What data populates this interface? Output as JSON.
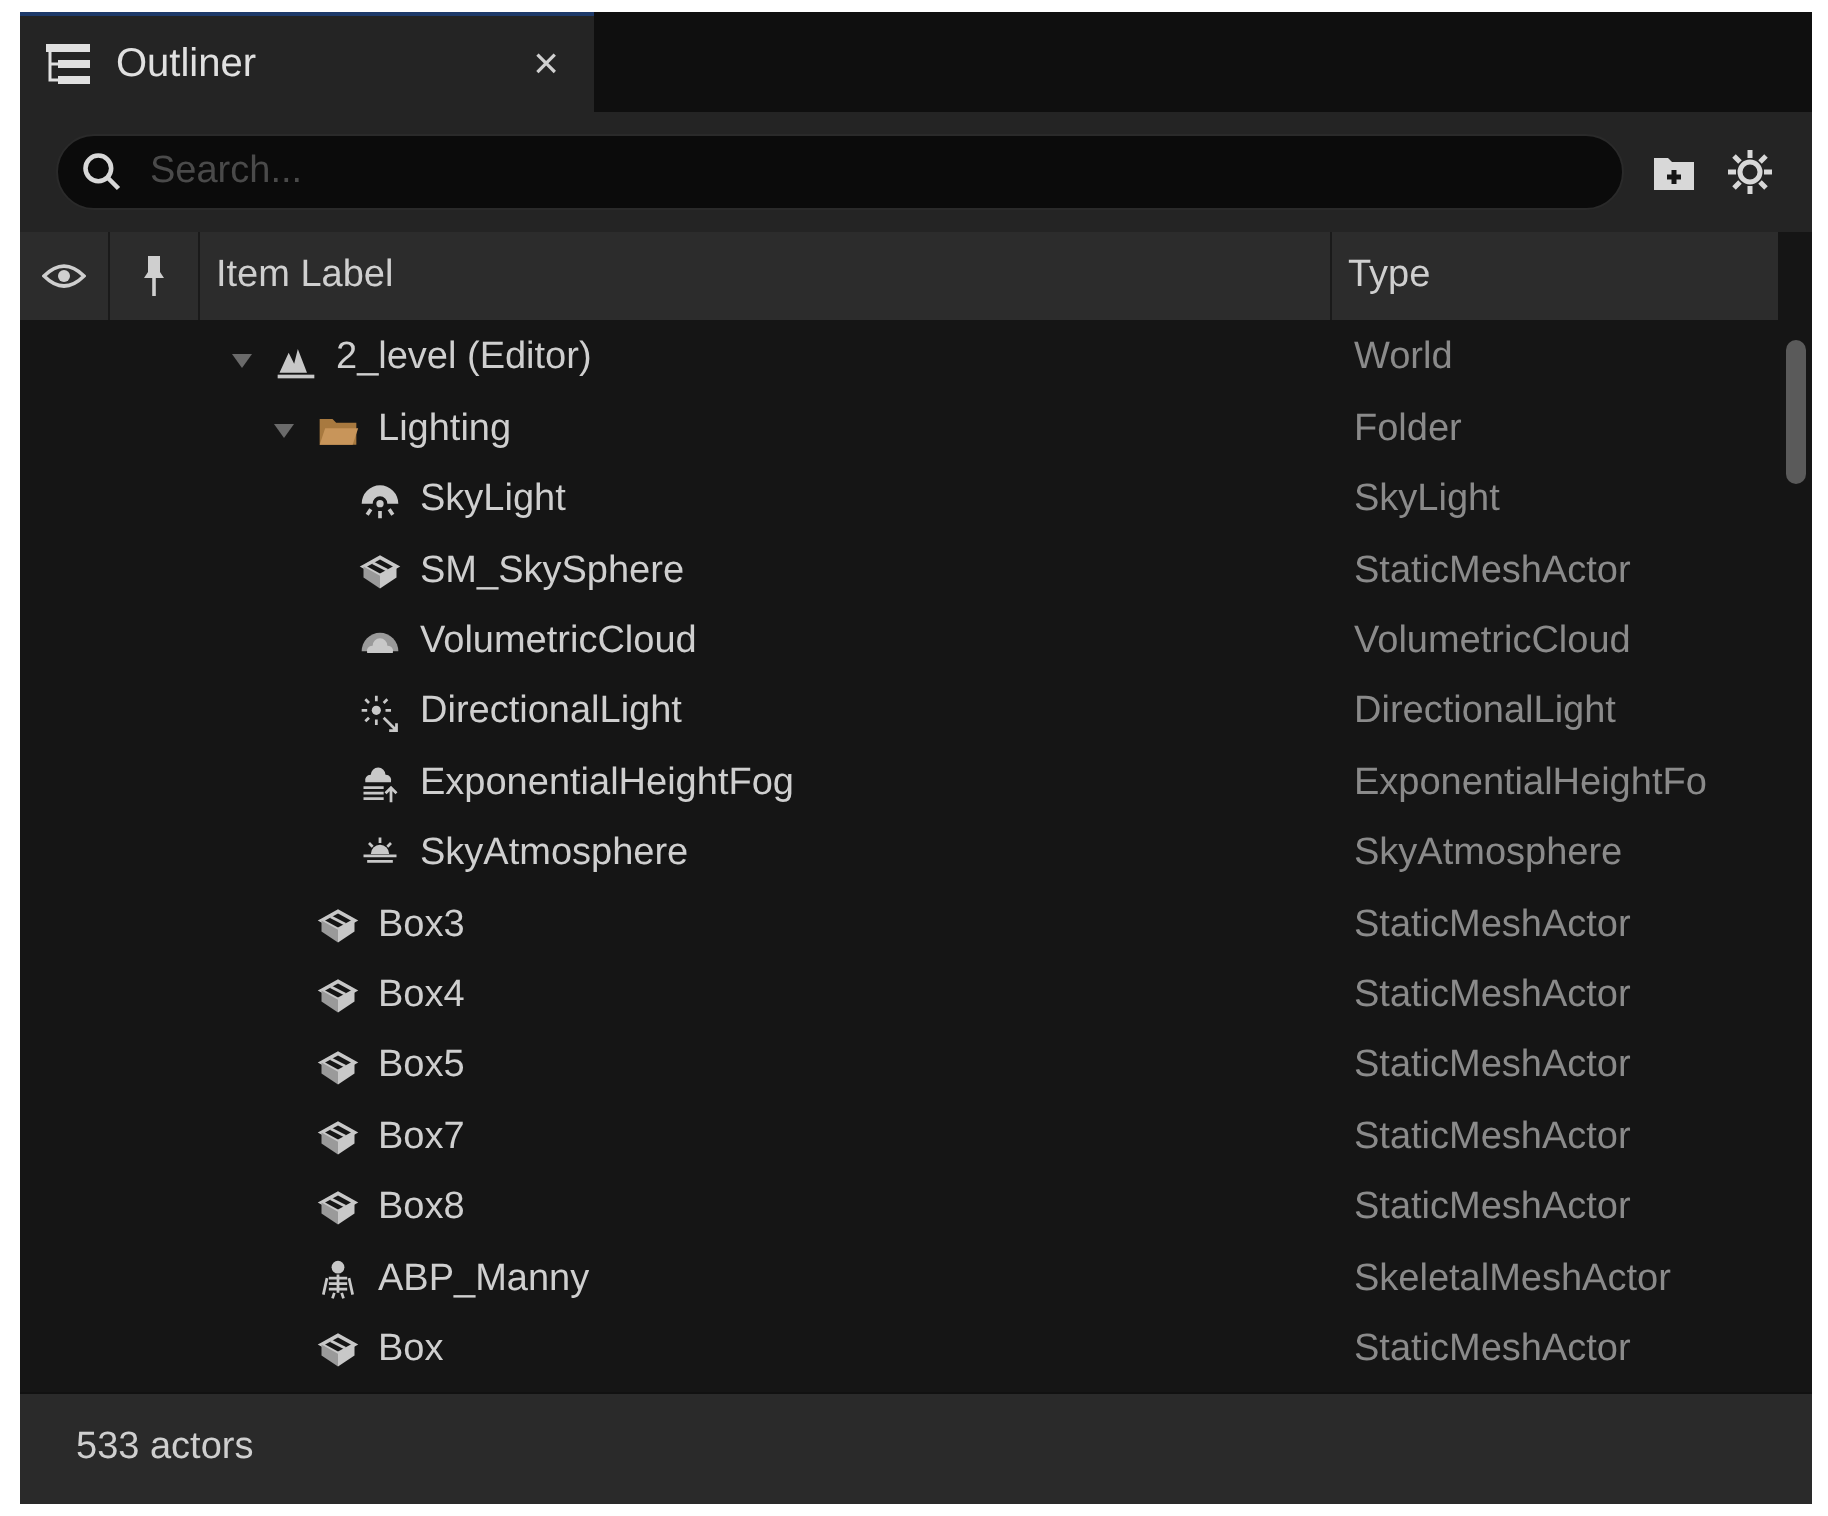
{
  "tab": {
    "title": "Outliner",
    "close": "×"
  },
  "search": {
    "placeholder": "Search..."
  },
  "columns": {
    "label": "Item Label",
    "type": "Type"
  },
  "tree": [
    {
      "label": "2_level (Editor)",
      "type": "World",
      "kind": "world",
      "expanded": true,
      "children": [
        {
          "label": "Lighting",
          "type": "Folder",
          "kind": "folder",
          "expanded": true,
          "children": [
            {
              "label": "SkyLight",
              "type": "SkyLight",
              "kind": "skylight"
            },
            {
              "label": "SM_SkySphere",
              "type": "StaticMeshActor",
              "kind": "mesh"
            },
            {
              "label": "VolumetricCloud",
              "type": "VolumetricCloud",
              "kind": "cloud"
            },
            {
              "label": "DirectionalLight",
              "type": "DirectionalLight",
              "kind": "sun"
            },
            {
              "label": "ExponentialHeightFog",
              "type": "ExponentialHeightFo",
              "kind": "fog"
            },
            {
              "label": "SkyAtmosphere",
              "type": "SkyAtmosphere",
              "kind": "atmosphere"
            }
          ]
        },
        {
          "label": "Box3",
          "type": "StaticMeshActor",
          "kind": "mesh"
        },
        {
          "label": "Box4",
          "type": "StaticMeshActor",
          "kind": "mesh"
        },
        {
          "label": "Box5",
          "type": "StaticMeshActor",
          "kind": "mesh"
        },
        {
          "label": "Box7",
          "type": "StaticMeshActor",
          "kind": "mesh"
        },
        {
          "label": "Box8",
          "type": "StaticMeshActor",
          "kind": "mesh"
        },
        {
          "label": "ABP_Manny",
          "type": "SkeletalMeshActor",
          "kind": "skeleton"
        },
        {
          "label": "Box",
          "type": "StaticMeshActor",
          "kind": "mesh"
        }
      ]
    }
  ],
  "status_bar": "533 actors"
}
